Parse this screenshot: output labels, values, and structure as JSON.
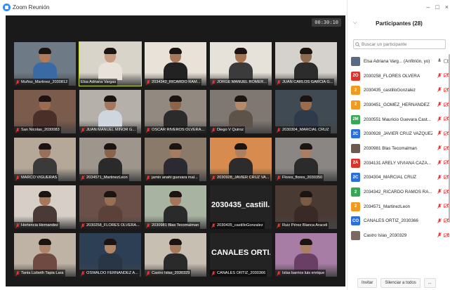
{
  "window": {
    "title": "Zoom Reunión",
    "controls": [
      "–",
      "□",
      "×"
    ]
  },
  "meeting": {
    "timer": "00:30:10",
    "tiles": [
      {
        "name": "Muñoz_Martinez_2030812",
        "skin": "#b07b5b",
        "shirt": "#3a6aa3",
        "room": "#6e7a86",
        "muted": true
      },
      {
        "name": "Elsa Adriana Vargas",
        "skin": "#c79c80",
        "shirt": "#e8e2da",
        "room": "#d9d4c9",
        "muted": false,
        "active": true
      },
      {
        "name": "2034342_RICARDO RAM...",
        "skin": "#a8785a",
        "shirt": "#222222",
        "room": "#e9e2d8",
        "muted": true
      },
      {
        "name": "JORGE MANUEL ROMER...",
        "skin": "#a57453",
        "shirt": "#3b3b3b",
        "room": "#e6e1d9",
        "muted": true
      },
      {
        "name": "JUAN CARLOS GARCIA G...",
        "skin": "#8f6a4f",
        "shirt": "#2c2c2c",
        "room": "#d5d2cd",
        "muted": true
      },
      {
        "name": "San Nicolas_2030083",
        "skin": "#9b6a50",
        "shirt": "#4a2e28",
        "room": "#7b5b4c",
        "muted": true
      },
      {
        "name": "JUAN MANUEL MINOR G...",
        "skin": "#a2775c",
        "shirt": "#cfd6dd",
        "room": "#b5b0a9",
        "muted": true
      },
      {
        "name": "OSCAR RIVEROS OLVERA ...",
        "skin": "#8c644a",
        "shirt": "#2b2b2b",
        "room": "#928a80",
        "muted": true
      },
      {
        "name": "Diego V Quiroz",
        "skin": "#b5896b",
        "shirt": "#5e5348",
        "room": "#7f7872",
        "muted": true
      },
      {
        "name": "2030304_MARCIAL CRUZ",
        "skin": "#9a6b4c",
        "shirt": "#2f3a4a",
        "room": "#3f4a52",
        "muted": true
      },
      {
        "name": "MARCO VIGUERAS",
        "skin": "#9a7158",
        "shirt": "#3a3a3a",
        "room": "#b6a898",
        "muted": true
      },
      {
        "name": "2034571_MartinezLeon",
        "skin": "#8b6349",
        "shirt": "#2a2a2a",
        "room": "#9e968c",
        "muted": true
      },
      {
        "name": "jamin anahi guevara mal...",
        "skin": "#a67b5f",
        "shirt": "#2a2a30",
        "room": "#8a7a6a",
        "muted": true
      },
      {
        "name": "2030928_JAVIER CRUZ VA...",
        "skin": "#b07f60",
        "shirt": "#2c2c2c",
        "room": "#d78b4e",
        "muted": true
      },
      {
        "name": "Flores_flores_2030350",
        "skin": "#a97e62",
        "shirt": "#2b2b2b",
        "room": "#8a8684",
        "muted": true
      },
      {
        "name": "Hortencia Hernandez",
        "skin": "#a5785b",
        "shirt": "#4a3a36",
        "room": "#d7cfc7",
        "muted": true
      },
      {
        "name": "2030258_FLORES OLVERA...",
        "skin": "#9a6e55",
        "shirt": "#5a4238",
        "room": "#6a5048",
        "muted": true
      },
      {
        "name": "2030981 Blas Tecomalman",
        "skin": "#a3765a",
        "shirt": "#2a2a2a",
        "room": "#a9b3a2",
        "muted": true
      },
      {
        "name": "2030435_castilloGonzalez",
        "bigtext": "2030435_castill...",
        "muted": true
      },
      {
        "name": "Ruiz Pérez Blanca Araceli",
        "skin": "#7b5a44",
        "shirt": "#3a2a26",
        "room": "#4a3a34",
        "muted": true
      },
      {
        "name": "Tania Lizbeth Tapia Lara",
        "skin": "#b08468",
        "shirt": "#6e4a40",
        "room": "#bfb3a5",
        "muted": true
      },
      {
        "name": "OSWALDO FERNANDEZ A...",
        "skin": "#b18566",
        "shirt": "#283646",
        "room": "#2d3f55",
        "muted": true
      },
      {
        "name": "Castro Islas_2030329",
        "skin": "#a77a5d",
        "shirt": "#2a2a2a",
        "room": "#c8bfb3",
        "muted": true
      },
      {
        "name": "CANALES ORTIZ_2030366",
        "bigtext": "CANALES ORTI...",
        "muted": true
      },
      {
        "name": "Islas barrios luis enrique",
        "skin": "#ac7f64",
        "shirt": "#6a3f66",
        "room": "#a77ca5",
        "muted": true
      }
    ]
  },
  "panel": {
    "title": "Participantes (28)",
    "search_placeholder": "Buscar un participante",
    "participants": [
      {
        "initials": "",
        "name": "Elsa Adriana Varg... (Anfitrión, yo)",
        "color": "#5a6a85",
        "photo": true,
        "muted": false
      },
      {
        "initials": "2O",
        "name": "2030258_FLORES OLVERA",
        "color": "#d9342b",
        "muted": true
      },
      {
        "initials": "2",
        "name": "2030435_castilloGonzalez",
        "color": "#f29a1f",
        "muted": true
      },
      {
        "initials": "2",
        "name": "2030451_GOMEZ_HERNANDEZ",
        "color": "#f29a1f",
        "muted": true
      },
      {
        "initials": "2M",
        "name": "2030551 Mauricio Guevara Cast...",
        "color": "#34a853",
        "muted": true
      },
      {
        "initials": "2C",
        "name": "2030928_JAVIER CRUZ VAZQUEZ",
        "color": "#2d6fd9",
        "muted": true
      },
      {
        "initials": "",
        "name": "2030981 Blas Tecomalman",
        "color": "#6a5a50",
        "photo": true,
        "muted": true
      },
      {
        "initials": "2A",
        "name": "2034131 ARELY VIVIANA CAZA...",
        "color": "#d9342b",
        "muted": true
      },
      {
        "initials": "2C",
        "name": "2034304_MARCIAL CRUZ",
        "color": "#2d6fd9",
        "muted": true
      },
      {
        "initials": "2",
        "name": "2034342_RICARDO RAMOS RA...",
        "color": "#34a853",
        "muted": true
      },
      {
        "initials": "2",
        "name": "2034571_MartinezLeon",
        "color": "#f29a1f",
        "muted": true
      },
      {
        "initials": "CO",
        "name": "CANALES ORTIZ_2030366",
        "color": "#2d6fd9",
        "muted": true
      },
      {
        "initials": "",
        "name": "Castro Islas_2030329",
        "color": "#7a6a60",
        "photo": true,
        "muted": true
      }
    ],
    "invite_label": "Invitar",
    "mute_all_label": "Silenciar a todos",
    "more_label": "..."
  }
}
